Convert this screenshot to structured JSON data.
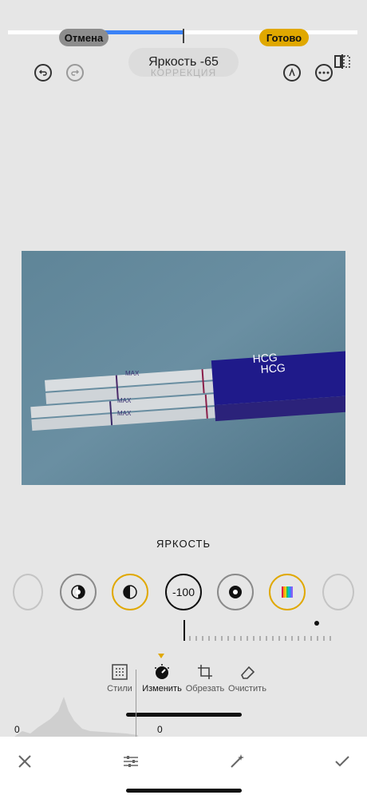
{
  "top": {
    "cancel_label": "Отмена",
    "done_label": "Готово",
    "tooltip": "Яркость -65",
    "correction_label": "КОРРЕКЦИЯ",
    "progress_fraction": 0.32
  },
  "header_icons": {
    "undo": "undo-icon",
    "redo": "redo-icon",
    "markup": "markup-pen-icon",
    "more": "more-icon",
    "compare": "split-compare-icon"
  },
  "photo": {
    "strip_labels": [
      "HCG",
      "HCG"
    ],
    "max_labels": [
      "MAX",
      "MAX",
      "MAX"
    ]
  },
  "adjustment": {
    "label": "ЯРКОСТЬ",
    "items": [
      {
        "name": "exposure",
        "icon": "exposure-icon"
      },
      {
        "name": "brilliance",
        "icon": "brilliance-icon"
      },
      {
        "name": "highlights",
        "icon": "highlights-icon"
      },
      {
        "name": "brightness",
        "icon": "brightness-value",
        "value": "-100"
      },
      {
        "name": "black-point",
        "icon": "black-point-icon"
      },
      {
        "name": "saturation",
        "icon": "saturation-icon"
      },
      {
        "name": "vibrance",
        "icon": "vibrance-icon"
      }
    ]
  },
  "tabs": [
    {
      "label": "Стили",
      "icon": "styles-icon"
    },
    {
      "label": "Изменить",
      "icon": "adjust-dial-icon"
    },
    {
      "label": "Обрезать",
      "icon": "crop-icon"
    },
    {
      "label": "Очистить",
      "icon": "eraser-icon"
    }
  ],
  "histogram": {
    "left_label": "0",
    "right_label": "0"
  },
  "bottom_toolbar": {
    "close": "close-icon",
    "adjust": "sliders-icon",
    "magic": "magic-wand-icon",
    "confirm": "check-icon"
  },
  "colors": {
    "accent": "#e0a800",
    "progress": "#3b82f6",
    "photo_bg": "#5b7f93"
  }
}
